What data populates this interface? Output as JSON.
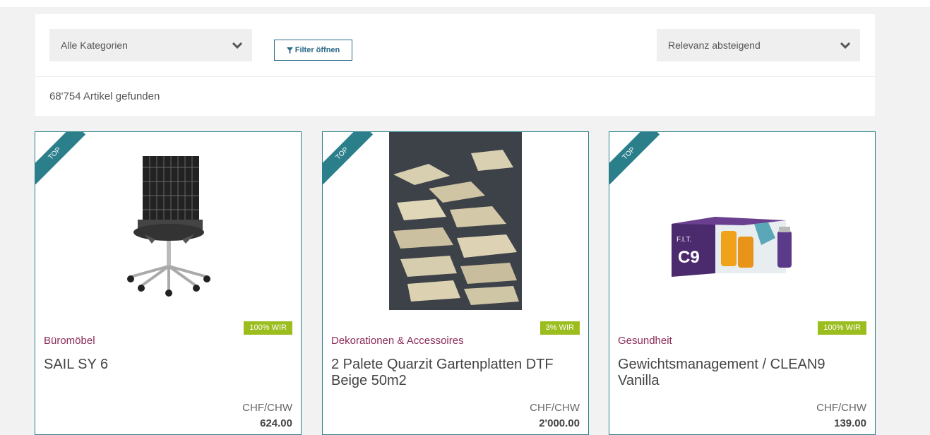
{
  "filters": {
    "category_select": "Alle Kategorien",
    "filter_button": "Filter öffnen",
    "sort_select": "Relevanz absteigend"
  },
  "results": {
    "count_text": "68'754 Artikel gefunden"
  },
  "products": [
    {
      "ribbon": "TOP",
      "badge": "100% WIR",
      "category": "Büromöbel",
      "title": "SAIL SY 6",
      "currency": "CHF/CHW",
      "price": "624.00"
    },
    {
      "ribbon": "TOP",
      "badge": "3% WIR",
      "category": "Dekorationen & Accessoires",
      "title": "2 Palete Quarzit Gartenplatten DTF Beige 50m2",
      "currency": "CHF/CHW",
      "price": "2'000.00"
    },
    {
      "ribbon": "TOP",
      "badge": "100% WIR",
      "category": "Gesundheit",
      "title": "Gewichtsmanagement / CLEAN9 Vanilla",
      "currency": "CHF/CHW",
      "price": "139.00"
    }
  ],
  "product_images": [
    "office chair with mesh back",
    "pile of beige quartzite garden stone slabs",
    "F.I.T. C9 Clean9 product kit"
  ],
  "icons": {
    "dropdown": "chevron-down-icon",
    "filter": "funnel-icon"
  },
  "colors": {
    "accent": "#2b7f8b",
    "badge": "#9bbd1e",
    "category": "#8b2a58",
    "button": "#2c6a8a"
  },
  "product_image_text": {
    "kit_box_a": "F.I.T.",
    "kit_box_b": "C9"
  }
}
